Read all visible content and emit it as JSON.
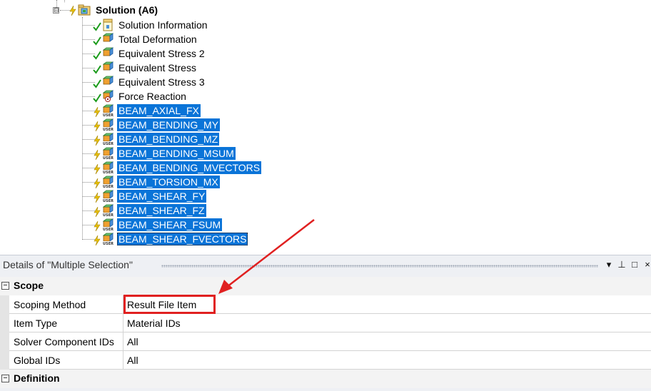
{
  "tree": {
    "root": {
      "label": "Solution (A6)",
      "expander": "⊟",
      "icon": "solution-folder-icon"
    },
    "children": [
      {
        "label": "Solution Information",
        "status": "check",
        "icon": "solution-info-icon",
        "selected": false
      },
      {
        "label": "Total Deformation",
        "status": "check",
        "icon": "result-icon",
        "selected": false
      },
      {
        "label": "Equivalent Stress 2",
        "status": "check",
        "icon": "result-icon",
        "selected": false
      },
      {
        "label": "Equivalent Stress",
        "status": "check",
        "icon": "result-icon",
        "selected": false
      },
      {
        "label": "Equivalent Stress 3",
        "status": "check",
        "icon": "result-icon",
        "selected": false
      },
      {
        "label": "Force Reaction",
        "status": "check",
        "icon": "probe-icon",
        "selected": false
      },
      {
        "label": "BEAM_AXIAL_FX",
        "status": "lightning",
        "icon": "user-defined-result-icon",
        "selected": true
      },
      {
        "label": "BEAM_BENDING_MY",
        "status": "lightning",
        "icon": "user-defined-result-icon",
        "selected": true
      },
      {
        "label": "BEAM_BENDING_MZ",
        "status": "lightning",
        "icon": "user-defined-result-icon",
        "selected": true
      },
      {
        "label": "BEAM_BENDING_MSUM",
        "status": "lightning",
        "icon": "user-defined-result-icon",
        "selected": true
      },
      {
        "label": "BEAM_BENDING_MVECTORS",
        "status": "lightning",
        "icon": "user-defined-result-icon",
        "selected": true
      },
      {
        "label": "BEAM_TORSION_MX",
        "status": "lightning",
        "icon": "user-defined-result-icon",
        "selected": true
      },
      {
        "label": "BEAM_SHEAR_FY",
        "status": "lightning",
        "icon": "user-defined-result-icon",
        "selected": true
      },
      {
        "label": "BEAM_SHEAR_FZ",
        "status": "lightning",
        "icon": "user-defined-result-icon",
        "selected": true
      },
      {
        "label": "BEAM_SHEAR_FSUM",
        "status": "lightning",
        "icon": "user-defined-result-icon",
        "selected": true
      },
      {
        "label": "BEAM_SHEAR_FVECTORS",
        "status": "lightning",
        "icon": "user-defined-result-icon",
        "selected": true,
        "focused": true
      }
    ],
    "user_badge": "USER"
  },
  "details": {
    "title": "Details of \"Multiple Selection\"",
    "buttons": {
      "dropdown": "▾",
      "pin": "⊥",
      "maximize": "□",
      "close": "×"
    },
    "sections": [
      {
        "label": "Scope",
        "expander": "−",
        "rows": [
          {
            "name": "Scoping Method",
            "value": "Result File Item",
            "highlighted": true
          },
          {
            "name": "Item Type",
            "value": "Material IDs"
          },
          {
            "name": "Solver Component IDs",
            "value": "All"
          },
          {
            "name": "Global IDs",
            "value": "All"
          }
        ]
      },
      {
        "label": "Definition",
        "expander": "−",
        "rows": []
      }
    ]
  },
  "colors": {
    "selection": "#0a74d8",
    "annotation": "#e02020",
    "check": "#1a9a1a",
    "lightning": "#e8c000"
  }
}
